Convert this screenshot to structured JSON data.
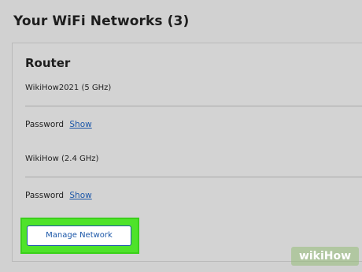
{
  "page": {
    "title": "Your WiFi Networks (3)"
  },
  "router_card": {
    "title": "Router",
    "networks": [
      {
        "name": "WikiHow2021 (5 GHz)",
        "password_label": "Password",
        "show_label": "Show"
      },
      {
        "name": "WikiHow (2.4 GHz)",
        "password_label": "Password",
        "show_label": "Show"
      }
    ],
    "manage_button_label": "Manage Network"
  },
  "watermark": {
    "text": "wikiHow"
  },
  "colors": {
    "link": "#1a56a8",
    "highlight": "#4ee32a",
    "background": "#d1d1d1"
  }
}
